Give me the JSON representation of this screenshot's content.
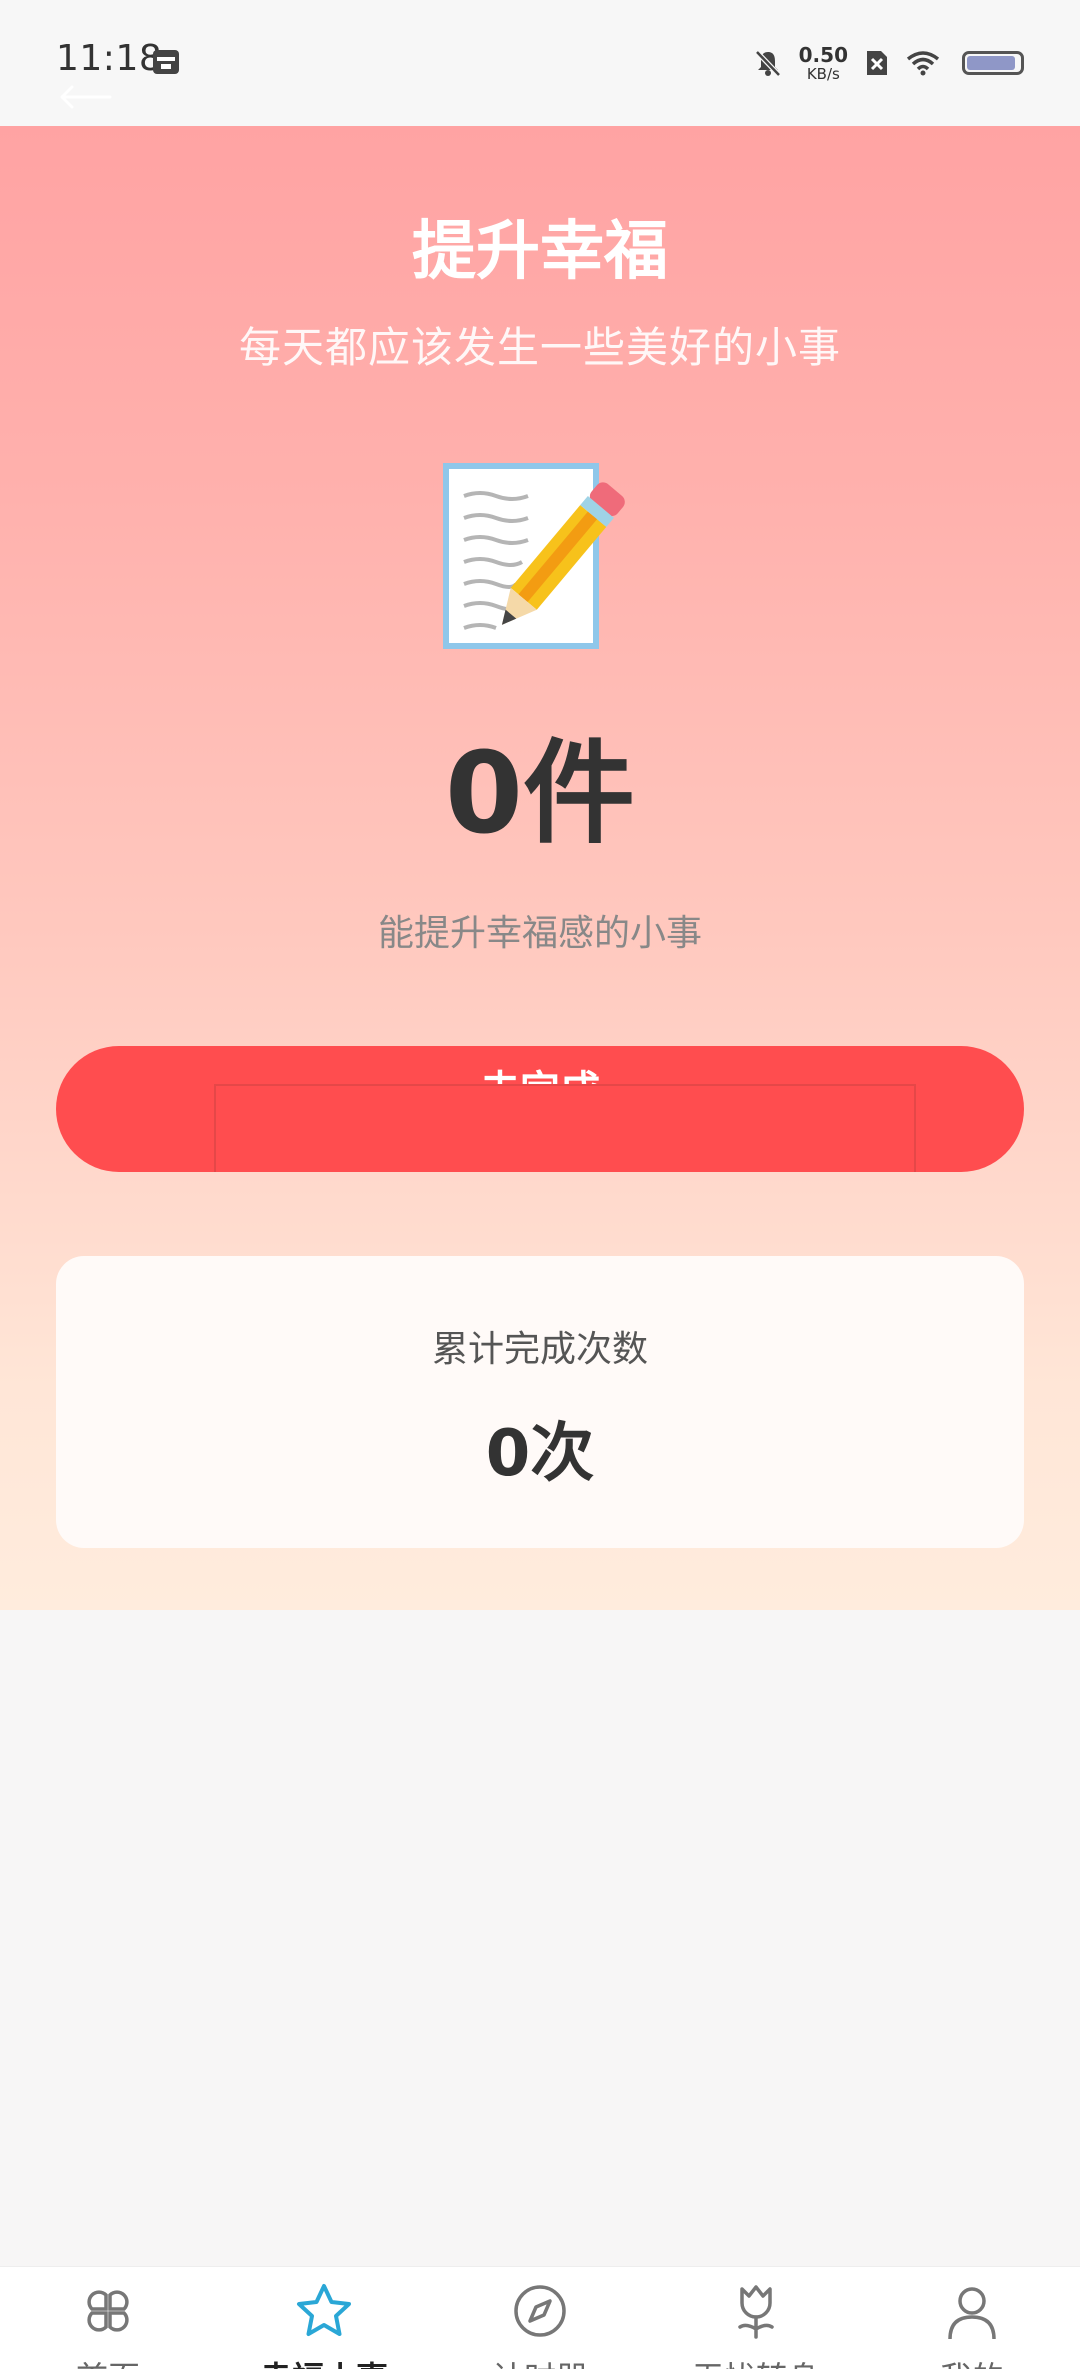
{
  "status_bar": {
    "time": "11:18",
    "net_speed_value": "0.50",
    "net_speed_unit": "KB/s",
    "battery_level": 0.92
  },
  "hero": {
    "title": "提升幸福",
    "subtitle": "每天都应该发生一些美好的小事",
    "icon": "memo-pencil-icon",
    "count": "0件",
    "count_desc": "能提升幸福感的小事"
  },
  "complete_button": {
    "label": "去完成"
  },
  "stats": {
    "label": "累计完成次数",
    "value": "0次"
  },
  "bottom_nav": {
    "active_index": 1,
    "items": [
      {
        "label": "首页",
        "icon": "four-petal-icon"
      },
      {
        "label": "幸福小事",
        "icon": "star-icon"
      },
      {
        "label": "计时器",
        "icon": "compass-icon"
      },
      {
        "label": "无忧转身",
        "icon": "tulip-icon"
      },
      {
        "label": "我的",
        "icon": "person-icon"
      }
    ]
  },
  "colors": {
    "accent": "#ff4d4f",
    "active_tab": "#2aa7d6"
  }
}
